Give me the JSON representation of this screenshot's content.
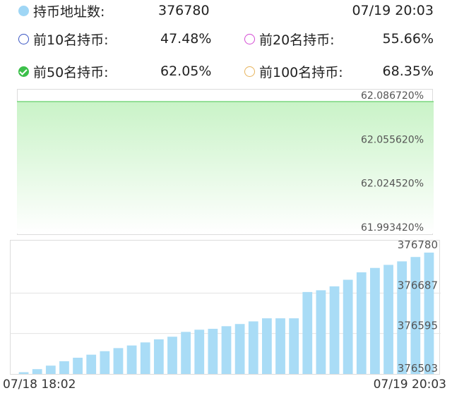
{
  "header": {
    "holders_label": "持币地址数:",
    "holders_value": "376780",
    "timestamp": "07/19 20:03"
  },
  "stats": {
    "top10_label": "前10名持币:",
    "top10_value": "47.48%",
    "top20_label": "前20名持币:",
    "top20_value": "55.66%",
    "top50_label": "前50名持币:",
    "top50_value": "62.05%",
    "top100_label": "前100名持币:",
    "top100_value": "68.35%"
  },
  "icons": {
    "holders": "filled-blue-dot-icon",
    "top10": "blue-ring-icon",
    "top20": "pink-ring-icon",
    "top50": "green-check-icon",
    "top100": "orange-ring-icon"
  },
  "colors": {
    "area_line": "#79d67e",
    "area_fill_top": "#c9f3c7",
    "bar_fill": "#a9dcf6",
    "axis_text": "#555555"
  },
  "x_axis": {
    "start_label": "07/18 18:02",
    "end_label": "07/19 20:03"
  },
  "chart_data": [
    {
      "type": "area",
      "ylim": [
        61.99342,
        62.08672
      ],
      "y_tick_labels": [
        "62.086720%",
        "62.055620%",
        "62.024520%",
        "61.993420%"
      ],
      "x": [
        "07/18 18:02",
        "07/19 20:03"
      ],
      "values": [
        62.08672,
        62.08672
      ],
      "grid": true
    },
    {
      "type": "bar",
      "ylim": [
        376503,
        376780
      ],
      "y_tick_labels": [
        "376780",
        "376687",
        "376595",
        "376503"
      ],
      "x_range": [
        "07/18 18:02",
        "07/19 20:03"
      ],
      "values": [
        376507,
        376514,
        376522,
        376532,
        376540,
        376547,
        376555,
        376562,
        376568,
        376575,
        376582,
        376588,
        376599,
        376604,
        376606,
        376612,
        376617,
        376623,
        376630,
        376630,
        376630,
        376690,
        376694,
        376703,
        376718,
        376735,
        376745,
        376752,
        376760,
        376770,
        376780
      ],
      "grid": true
    }
  ]
}
